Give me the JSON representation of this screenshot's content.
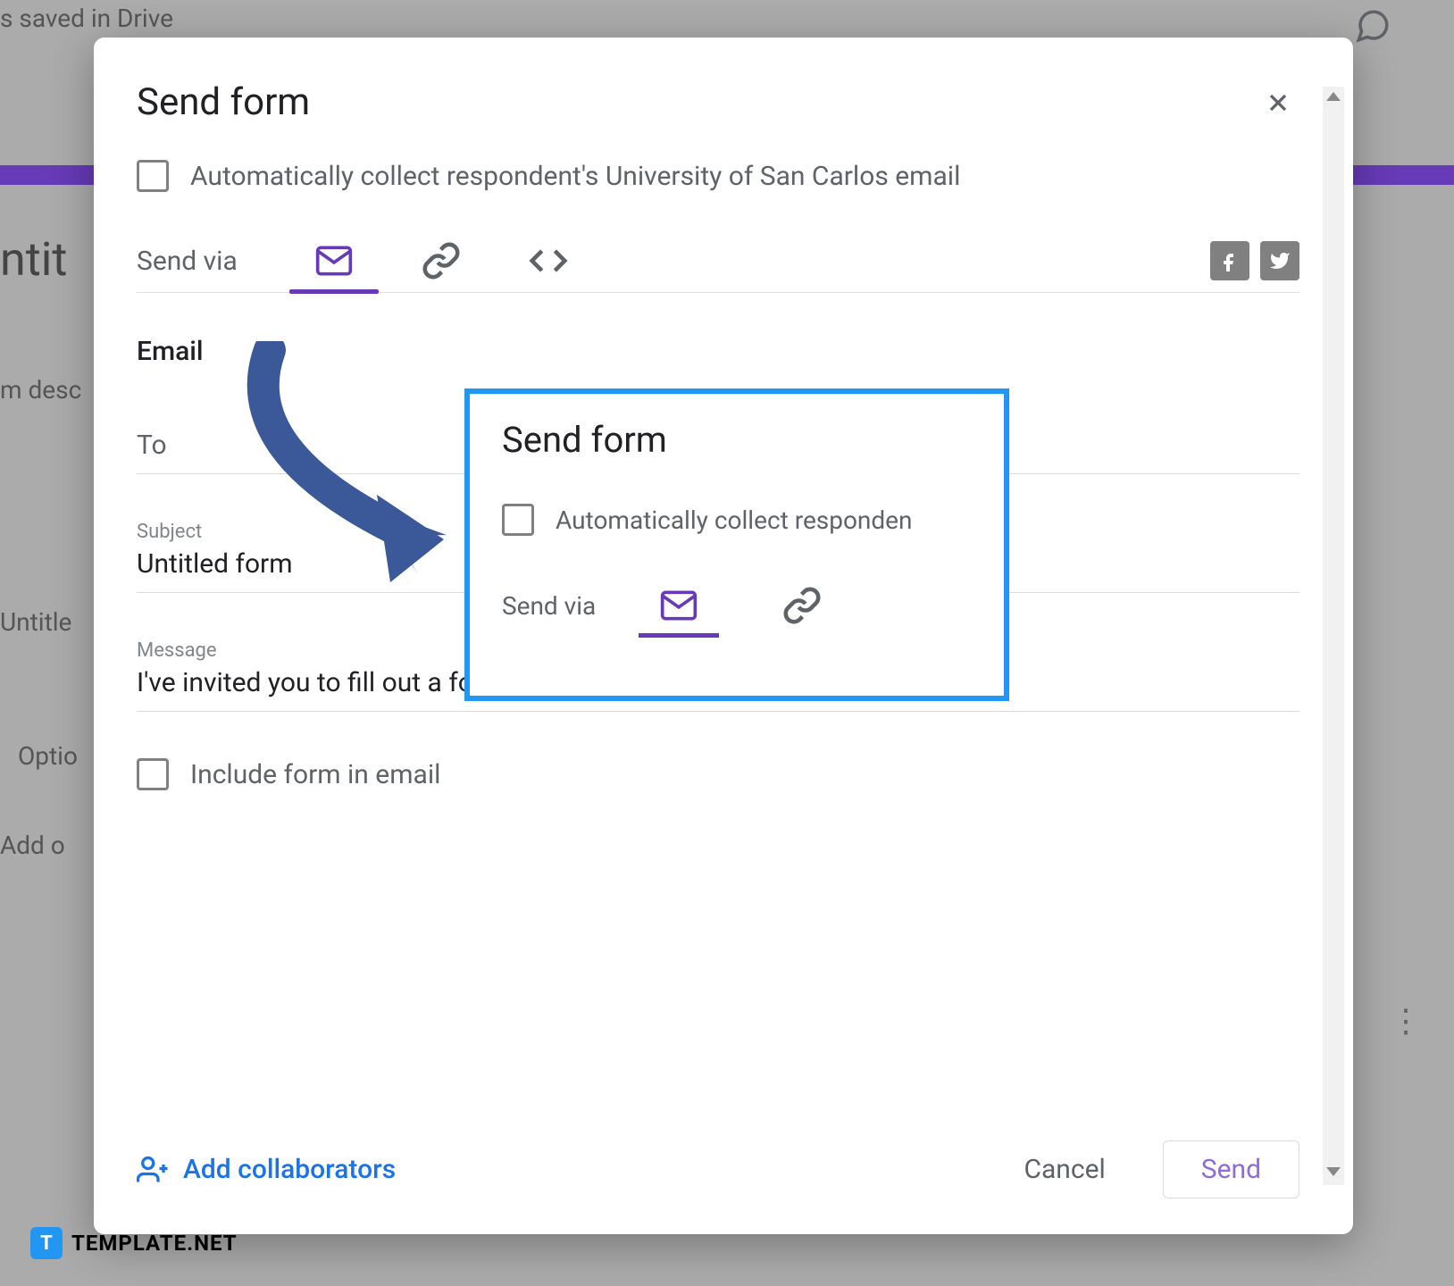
{
  "background": {
    "saved_status": "s saved in Drive",
    "form_title_partial": "ntit",
    "form_desc_partial": "m desc",
    "question_partial": "Untitle",
    "option_partial": "Optio",
    "add_option_partial": "Add o"
  },
  "modal": {
    "title": "Send form",
    "auto_collect_label": "Automatically collect respondent's University of San Carlos email",
    "send_via_label": "Send via",
    "email_heading": "Email",
    "to_label": "To",
    "subject_label": "Subject",
    "subject_value": "Untitled form",
    "message_label": "Message",
    "message_value": "I've invited you to fill out a form:",
    "include_form_label": "Include form in email",
    "add_collaborators_label": "Add collaborators",
    "cancel_label": "Cancel",
    "send_label": "Send"
  },
  "callout": {
    "title": "Send form",
    "auto_collect_label": "Automatically collect responden",
    "send_via_label": "Send via"
  },
  "watermark": {
    "icon_letter": "T",
    "text": "TEMPLATE.NET"
  }
}
